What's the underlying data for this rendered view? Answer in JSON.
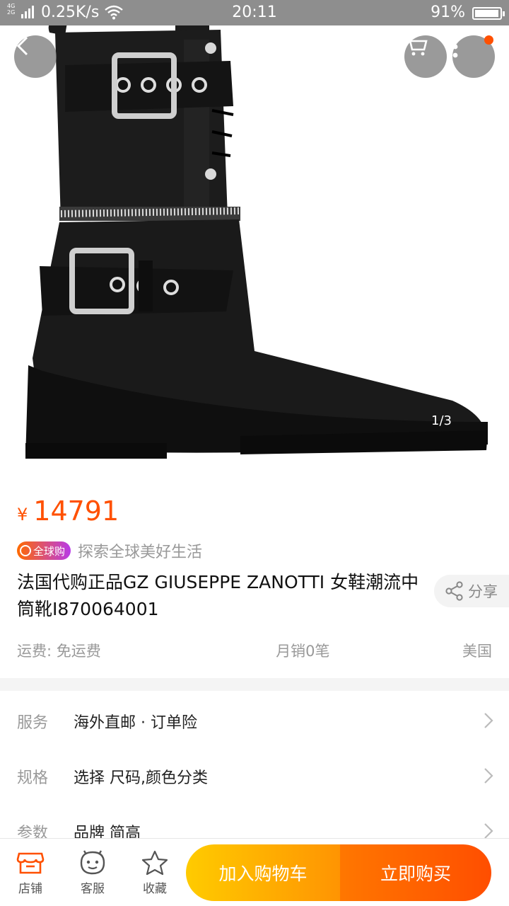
{
  "status_bar": {
    "network": "4G 2G",
    "speed": "0.25K/s",
    "time": "20:11",
    "battery": "91%",
    "battery_level": 0.91
  },
  "hero": {
    "pager": "1/3",
    "cart_badge_color": "#ff5000"
  },
  "product": {
    "currency": "¥",
    "price": "14791",
    "global_badge": "全球购",
    "slogan": "探索全球美好生活",
    "title": "法国代购正品GZ GIUSEPPE ZANOTTI 女鞋潮流中筒靴I870064001",
    "share_label": "分享",
    "shipping": "运费: 免运费",
    "monthly_sales": "月销0笔",
    "origin": "美国"
  },
  "info_rows": [
    {
      "key": "服务",
      "value": "海外直邮 · 订单险"
    },
    {
      "key": "规格",
      "value": "选择 尺码,颜色分类"
    },
    {
      "key": "参数",
      "value": "品牌 简高"
    }
  ],
  "bottom_bar": {
    "store_label": "店铺",
    "service_label": "客服",
    "favorite_label": "收藏",
    "add_to_cart_label": "加入购物车",
    "buy_now_label": "立即购买"
  },
  "colors": {
    "accent": "#ff5000",
    "cart_button": "#ffb000",
    "buy_button": "#ff5a00"
  },
  "icons": [
    "back-arrow-icon",
    "cart-icon",
    "more-icon",
    "share-icon",
    "chevron-right-icon",
    "store-icon",
    "service-icon",
    "star-icon"
  ]
}
